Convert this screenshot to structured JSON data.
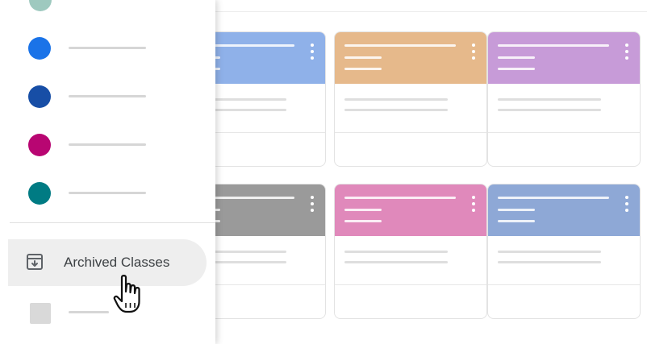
{
  "drawer": {
    "class_colors": [
      "#1a73e8",
      "#174ea6",
      "#b80672",
      "#007b83"
    ],
    "archived_label": "Archived Classes",
    "archived_icon": "archive-icon"
  },
  "cards": [
    {
      "color": "#8fb1e9"
    },
    {
      "color": "#e6b98b"
    },
    {
      "color": "#c79bd8"
    },
    {
      "color": "#9a9a9a"
    },
    {
      "color": "#e089bb"
    },
    {
      "color": "#8ea8d6"
    }
  ],
  "cursor_icon": "hand-pointer-icon"
}
